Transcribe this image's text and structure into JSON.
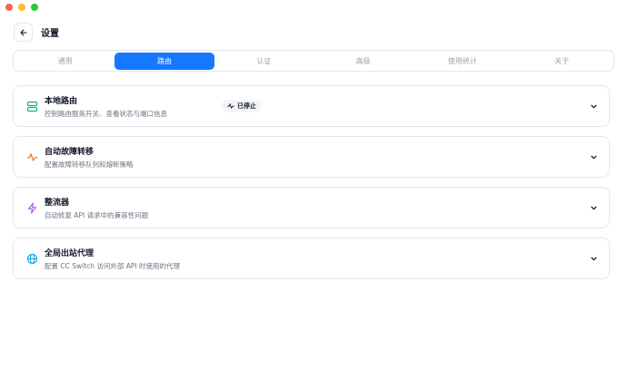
{
  "header": {
    "title": "设置"
  },
  "tabs": [
    {
      "label": "通用"
    },
    {
      "label": "路由"
    },
    {
      "label": "认证"
    },
    {
      "label": "高级"
    },
    {
      "label": "使用统计"
    },
    {
      "label": "关于"
    }
  ],
  "active_tab": 1,
  "cards": [
    {
      "title": "本地路由",
      "desc": "控制路由服务开关、查看状态与端口信息",
      "badge": "已停止",
      "icon": "server-icon",
      "color": "#10b981"
    },
    {
      "title": "自动故障转移",
      "desc": "配置故障转移队列和熔断策略",
      "icon": "activity-icon",
      "color": "#f97316"
    },
    {
      "title": "整流器",
      "desc": "自动修复 API 请求中的兼容性问题",
      "icon": "lightning-icon",
      "color": "#a855f7"
    },
    {
      "title": "全局出站代理",
      "desc": "配置 CC Switch 访问外部 API 时使用的代理",
      "icon": "globe-icon",
      "color": "#0ea5e9"
    }
  ]
}
